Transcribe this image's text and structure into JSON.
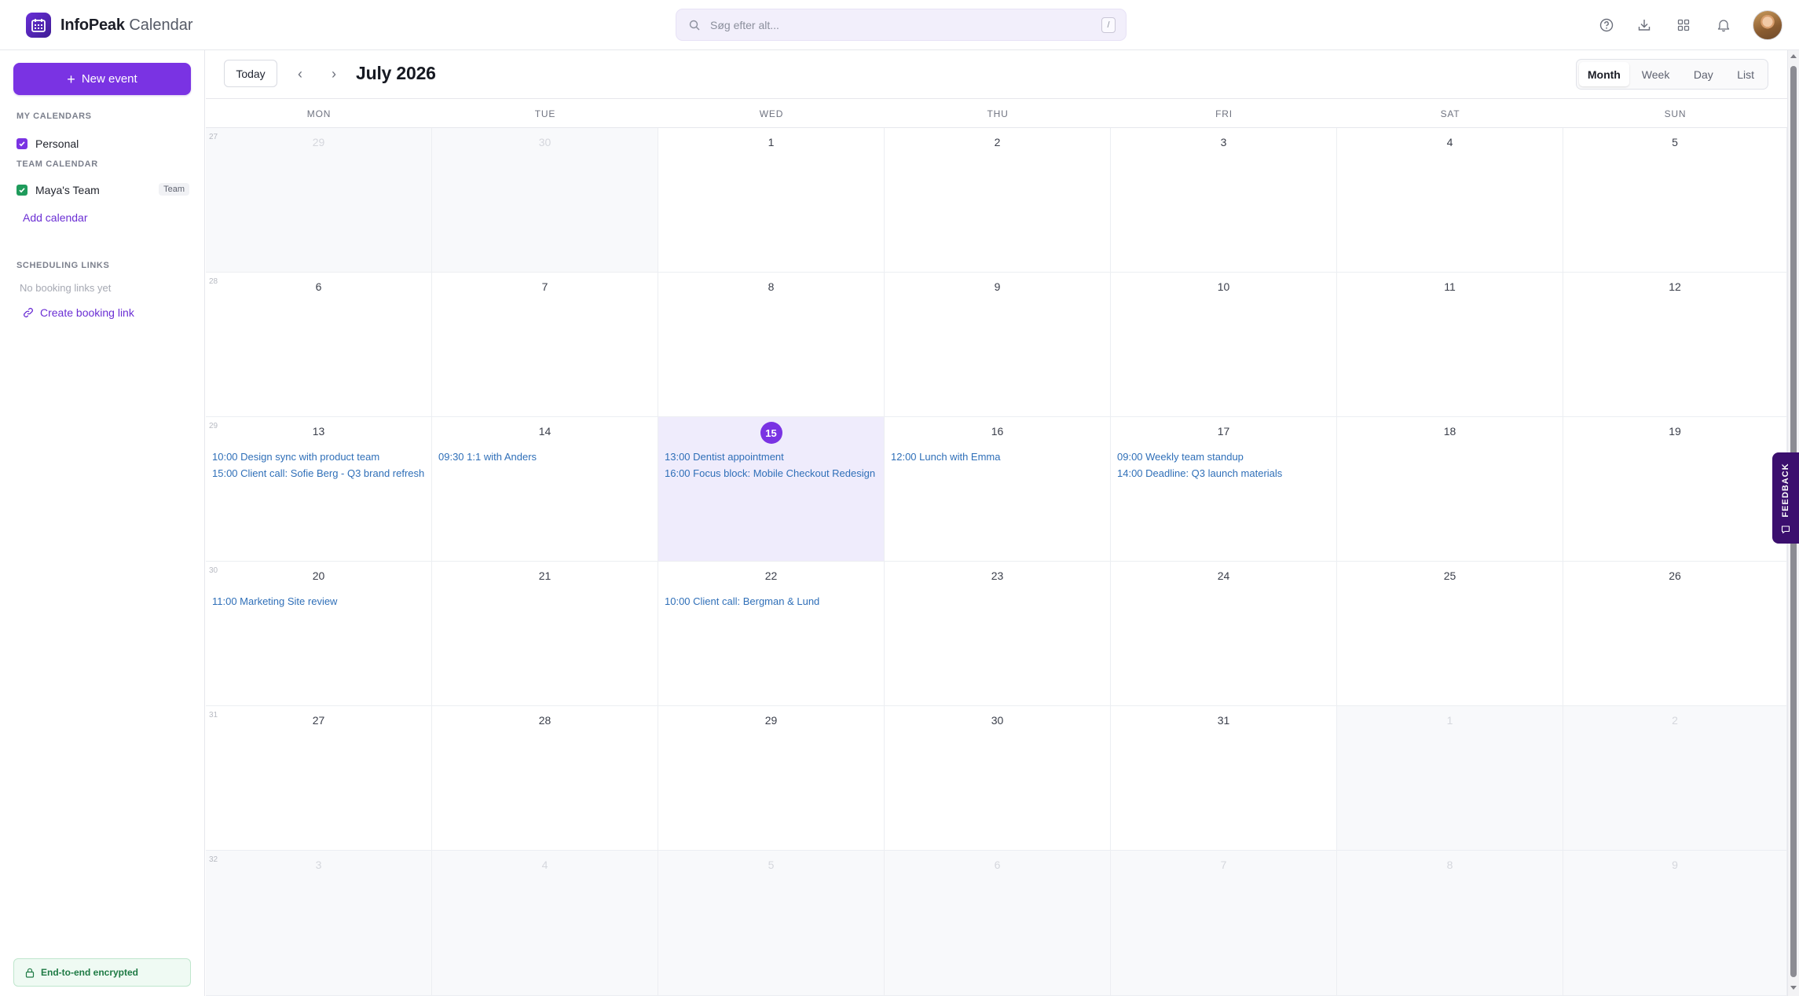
{
  "app": {
    "brand": "InfoPeak",
    "product": "Calendar"
  },
  "search": {
    "placeholder": "Søg efter alt...",
    "shortcut": "/"
  },
  "topbar_icons": [
    "help-icon",
    "download-icon",
    "apps-grid-icon",
    "bell-icon"
  ],
  "sidebar": {
    "new_event_label": "New event",
    "my_calendars_title": "MY CALENDARS",
    "my_calendars": [
      {
        "label": "Personal",
        "checked": true,
        "color": "#7a33e3"
      }
    ],
    "team_calendar_title": "TEAM CALENDAR",
    "team_calendars": [
      {
        "label": "Maya's Team",
        "badge": "Team",
        "checked": true,
        "color": "#1f9b5b"
      }
    ],
    "add_calendar_label": "Add calendar",
    "scheduling_title": "SCHEDULING LINKS",
    "scheduling_empty": "No booking links yet",
    "create_booking_label": "Create booking link",
    "encryption_label": "End-to-end encrypted"
  },
  "header": {
    "today_label": "Today",
    "month_title": "July 2026",
    "views": [
      {
        "label": "Month",
        "active": true
      },
      {
        "label": "Week",
        "active": false
      },
      {
        "label": "Day",
        "active": false
      },
      {
        "label": "List",
        "active": false
      }
    ]
  },
  "calendar": {
    "weekdays": [
      "MON",
      "TUE",
      "WED",
      "THU",
      "FRI",
      "SAT",
      "SUN"
    ],
    "weeks": [
      {
        "week": "27",
        "days": [
          {
            "day": "29",
            "out": true,
            "events": []
          },
          {
            "day": "30",
            "out": true,
            "events": []
          },
          {
            "day": "1",
            "events": []
          },
          {
            "day": "2",
            "events": []
          },
          {
            "day": "3",
            "events": []
          },
          {
            "day": "4",
            "events": []
          },
          {
            "day": "5",
            "events": []
          }
        ]
      },
      {
        "week": "28",
        "days": [
          {
            "day": "6",
            "events": []
          },
          {
            "day": "7",
            "events": []
          },
          {
            "day": "8",
            "events": []
          },
          {
            "day": "9",
            "events": []
          },
          {
            "day": "10",
            "events": []
          },
          {
            "day": "11",
            "events": []
          },
          {
            "day": "12",
            "events": []
          }
        ]
      },
      {
        "week": "29",
        "days": [
          {
            "day": "13",
            "events": [
              "10:00 Design sync with product team",
              "15:00 Client call: Sofie Berg - Q3 brand refresh"
            ]
          },
          {
            "day": "14",
            "events": [
              "09:30 1:1 with Anders"
            ]
          },
          {
            "day": "15",
            "today": true,
            "events": [
              "13:00 Dentist appointment",
              "16:00 Focus block: Mobile Checkout Redesign"
            ]
          },
          {
            "day": "16",
            "events": [
              "12:00 Lunch with Emma"
            ]
          },
          {
            "day": "17",
            "events": [
              "09:00 Weekly team standup",
              "14:00 Deadline: Q3 launch materials"
            ]
          },
          {
            "day": "18",
            "events": []
          },
          {
            "day": "19",
            "events": []
          }
        ]
      },
      {
        "week": "30",
        "days": [
          {
            "day": "20",
            "events": [
              "11:00 Marketing Site review"
            ]
          },
          {
            "day": "21",
            "events": []
          },
          {
            "day": "22",
            "events": [
              "10:00 Client call: Bergman & Lund"
            ]
          },
          {
            "day": "23",
            "events": []
          },
          {
            "day": "24",
            "events": []
          },
          {
            "day": "25",
            "events": []
          },
          {
            "day": "26",
            "events": []
          }
        ]
      },
      {
        "week": "31",
        "days": [
          {
            "day": "27",
            "events": []
          },
          {
            "day": "28",
            "events": []
          },
          {
            "day": "29",
            "events": []
          },
          {
            "day": "30",
            "events": []
          },
          {
            "day": "31",
            "events": []
          },
          {
            "day": "1",
            "out": true,
            "events": []
          },
          {
            "day": "2",
            "out": true,
            "events": []
          }
        ]
      },
      {
        "week": "32",
        "days": [
          {
            "day": "3",
            "out": true,
            "events": []
          },
          {
            "day": "4",
            "out": true,
            "events": []
          },
          {
            "day": "5",
            "out": true,
            "events": []
          },
          {
            "day": "6",
            "out": true,
            "events": []
          },
          {
            "day": "7",
            "out": true,
            "events": []
          },
          {
            "day": "8",
            "out": true,
            "events": []
          },
          {
            "day": "9",
            "out": true,
            "events": []
          }
        ]
      }
    ]
  },
  "feedback": {
    "label": "FEEDBACK"
  },
  "colors": {
    "accent": "#7a33e3",
    "event_text": "#2f6fb8",
    "today_bg": "#efecfc"
  }
}
